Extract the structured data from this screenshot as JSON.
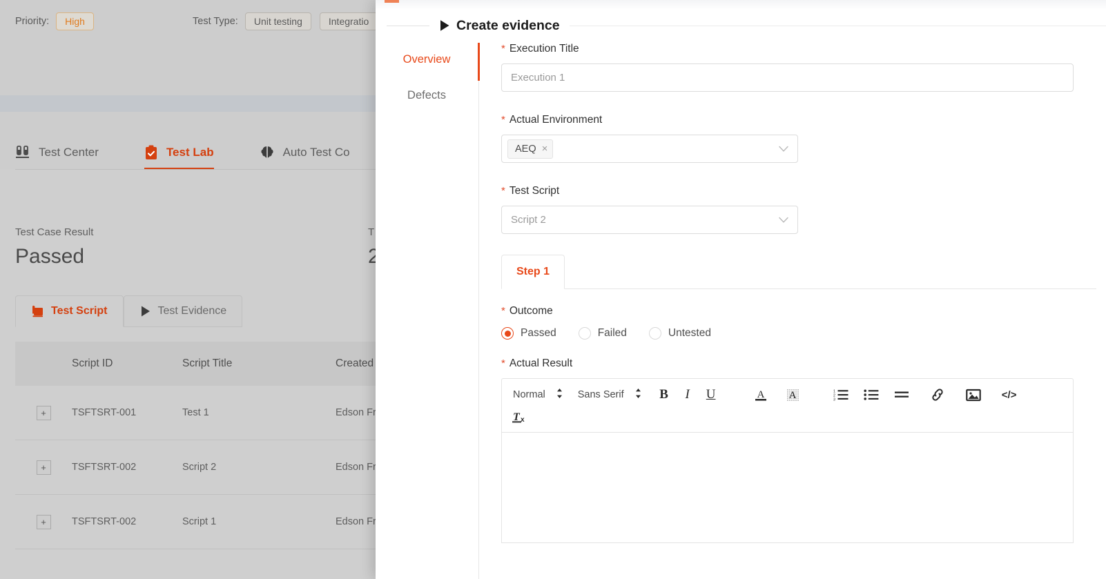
{
  "background": {
    "filters": {
      "priority_label": "Priority:",
      "priority_value": "High",
      "test_type_label": "Test Type:",
      "test_type_values": [
        "Unit testing",
        "Integratio"
      ]
    },
    "tabs": [
      {
        "label": "Test Center",
        "icon": "test-tubes-icon",
        "active": false
      },
      {
        "label": "Test Lab",
        "icon": "clipboard-check-icon",
        "active": true
      },
      {
        "label": "Auto Test Co",
        "icon": "brain-icon",
        "active": false
      }
    ],
    "summary": {
      "result_label": "Test Case Result",
      "result_value": "Passed",
      "second_label": "T",
      "second_value": "2"
    },
    "subtabs": [
      {
        "label": "Test Script",
        "icon": "script-icon",
        "active": true
      },
      {
        "label": "Test Evidence",
        "icon": "play-icon",
        "active": false
      }
    ],
    "table": {
      "columns": [
        "Script ID",
        "Script Title",
        "Created"
      ],
      "expand_symbol": "+",
      "rows": [
        {
          "id": "TSFTSRT-001",
          "title": "Test 1",
          "created": "Edson Fr"
        },
        {
          "id": "TSFTSRT-002",
          "title": "Script 2",
          "created": "Edson Fr"
        },
        {
          "id": "TSFTSRT-002",
          "title": "Script 1",
          "created": "Edson Fr"
        }
      ]
    }
  },
  "modal": {
    "title": "Create evidence",
    "nav": [
      {
        "label": "Overview",
        "active": true
      },
      {
        "label": "Defects",
        "active": false
      }
    ],
    "form": {
      "execution_title": {
        "label": "Execution Title",
        "required_marker": "*",
        "value": "",
        "placeholder": "Execution 1"
      },
      "actual_environment": {
        "label": "Actual Environment",
        "required_marker": "*",
        "tag": "AEQ",
        "tag_remove": "×"
      },
      "test_script": {
        "label": "Test Script",
        "required_marker": "*",
        "value": "Script 2"
      },
      "step_tabs": [
        {
          "label": "Step 1",
          "active": true
        }
      ],
      "outcome": {
        "label": "Outcome",
        "required_marker": "*",
        "options": [
          {
            "label": "Passed",
            "selected": true
          },
          {
            "label": "Failed",
            "selected": false
          },
          {
            "label": "Untested",
            "selected": false
          }
        ]
      },
      "actual_result": {
        "label": "Actual Result",
        "required_marker": "*",
        "toolbar": {
          "heading_picker": "Normal",
          "font_picker": "Sans Serif",
          "buttons": [
            {
              "name": "bold",
              "glyph": "B"
            },
            {
              "name": "italic",
              "glyph": "I"
            },
            {
              "name": "underline",
              "glyph": "U"
            },
            {
              "name": "text-color",
              "glyph": "A"
            },
            {
              "name": "background-color",
              "glyph": "A"
            },
            {
              "name": "ordered-list",
              "glyph": ""
            },
            {
              "name": "bullet-list",
              "glyph": ""
            },
            {
              "name": "align",
              "glyph": ""
            },
            {
              "name": "link",
              "glyph": ""
            },
            {
              "name": "image",
              "glyph": ""
            },
            {
              "name": "code",
              "glyph": "</>"
            },
            {
              "name": "clear-format",
              "glyph": "Tx"
            }
          ]
        },
        "content": ""
      }
    }
  },
  "colors": {
    "accent": "#e8491a",
    "accent_dark": "#d4400f",
    "required": "#e24a2a",
    "backdrop": "#cfcfcf"
  }
}
